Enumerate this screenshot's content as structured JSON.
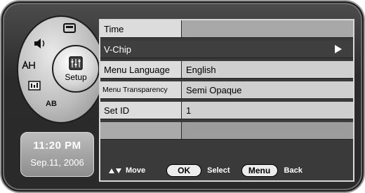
{
  "dial": {
    "hub_label": "Setup",
    "icons": [
      "picture-icon",
      "sound-icon",
      "channel-icon",
      "input-icon",
      "language-icon"
    ],
    "language_label": "AB"
  },
  "clock": {
    "time": "11:20 PM",
    "date": "Sep.11, 2006"
  },
  "menu": {
    "rows": [
      {
        "label": "Time",
        "value": ""
      },
      {
        "label": "V-Chip",
        "value": ""
      },
      {
        "label": "Menu Language",
        "value": "English"
      },
      {
        "label": "Menu Transparency",
        "value": "Semi Opaque"
      },
      {
        "label": "Set ID",
        "value": "1"
      },
      {
        "label": "",
        "value": ""
      }
    ],
    "selected_index": 1
  },
  "footer": {
    "move_label": "Move",
    "ok_label": "OK",
    "select_label": "Select",
    "menu_label": "Menu",
    "back_label": "Back"
  }
}
